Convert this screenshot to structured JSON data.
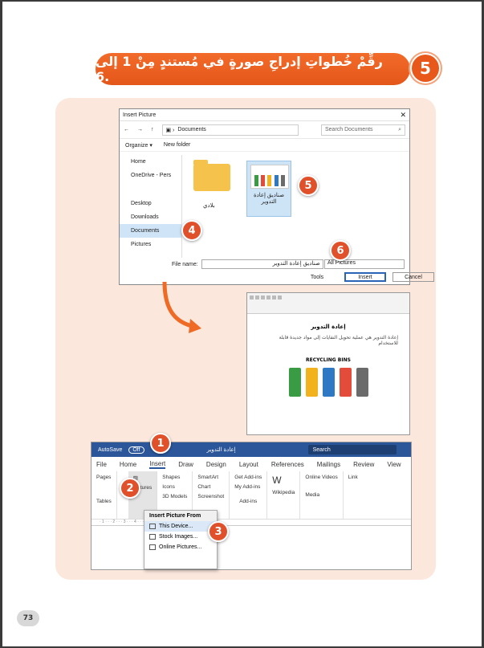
{
  "header": {
    "number": "5",
    "title": "رقِّمْ خُطواتِ إدراجِ صورةٍ في مُستندٍ مِنْ 1 إلى 6."
  },
  "dialog": {
    "title": "Insert Picture",
    "path": "Documents",
    "search": "Search Documents",
    "organize": "Organize ▾",
    "new_folder": "New folder",
    "sidebar": [
      "Home",
      "OneDrive - Pers",
      "Desktop",
      "Downloads",
      "Documents",
      "Pictures"
    ],
    "folder_name": "بلادي",
    "file_name_label": "File name:",
    "file_name": "صناديق إعادة التدوير",
    "thumb_label": "صناديق إعادة التدوير",
    "file_type": "All Pictures",
    "tools": "Tools",
    "insert": "Insert",
    "cancel": "Cancel"
  },
  "doc": {
    "title": "إعادة التدوير",
    "body": "إعادة التدوير هي عملية تحويل النفايات إلى مواد جديدة قابلة للاستخدام",
    "chart": "RECYCLING BINS"
  },
  "word": {
    "autosave": "AutoSave",
    "toggle": "Off",
    "doc_name": "إعادة التدوير",
    "search": "Search",
    "tabs": [
      "File",
      "Home",
      "Insert",
      "Draw",
      "Design",
      "Layout",
      "References",
      "Mailings",
      "Review",
      "View"
    ],
    "pages": "Pages",
    "tables": "Tables",
    "pictures": "Pictures",
    "shapes": "Shapes",
    "icons": "Icons",
    "models": "3D Models",
    "smartart": "SmartArt",
    "chart": "Chart",
    "screenshot": "Screenshot",
    "addins": "Get Add-ins",
    "myaddins": "My Add-ins",
    "wiki": "Wikipedia",
    "online": "Online Videos",
    "addins_grp": "Add-ins",
    "media": "Media",
    "link": "Link"
  },
  "dropdown": {
    "header": "Insert Picture From",
    "items": [
      "This Device...",
      "Stock Images...",
      "Online Pictures..."
    ]
  },
  "badges": [
    "1",
    "2",
    "3",
    "4",
    "5",
    "6"
  ],
  "page_number": "73",
  "colors": {
    "accent": "#e0502a",
    "panel": "#fbe7dc",
    "word_blue": "#2b579a"
  }
}
